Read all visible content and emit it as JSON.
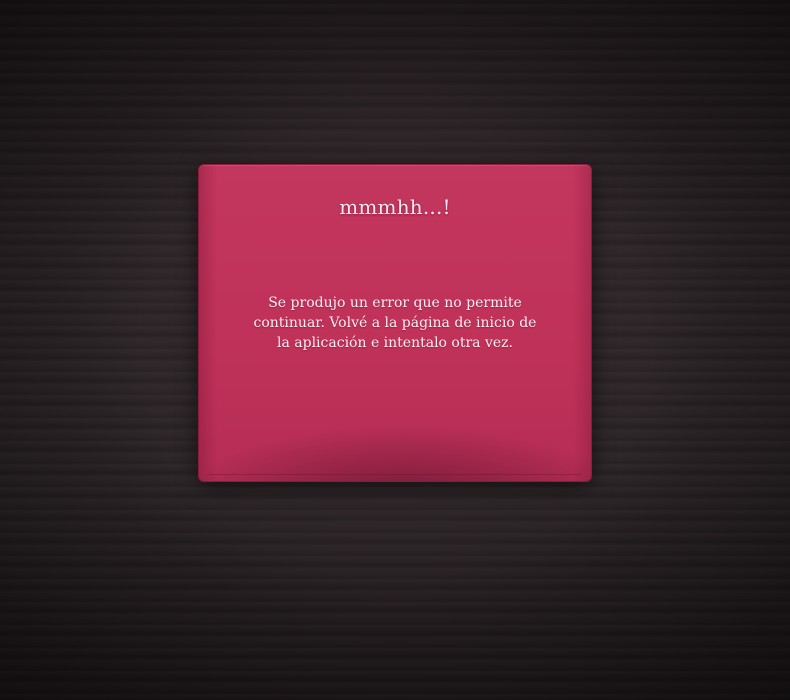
{
  "error_card": {
    "title": "mmmhh...!",
    "message": "Se produjo un error que no permite continuar. Volvé a la página de inicio de la aplicación e intentalo otra vez."
  },
  "colors": {
    "background": "#2a2224",
    "card": "#c3345c",
    "text": "#fbeff3"
  }
}
